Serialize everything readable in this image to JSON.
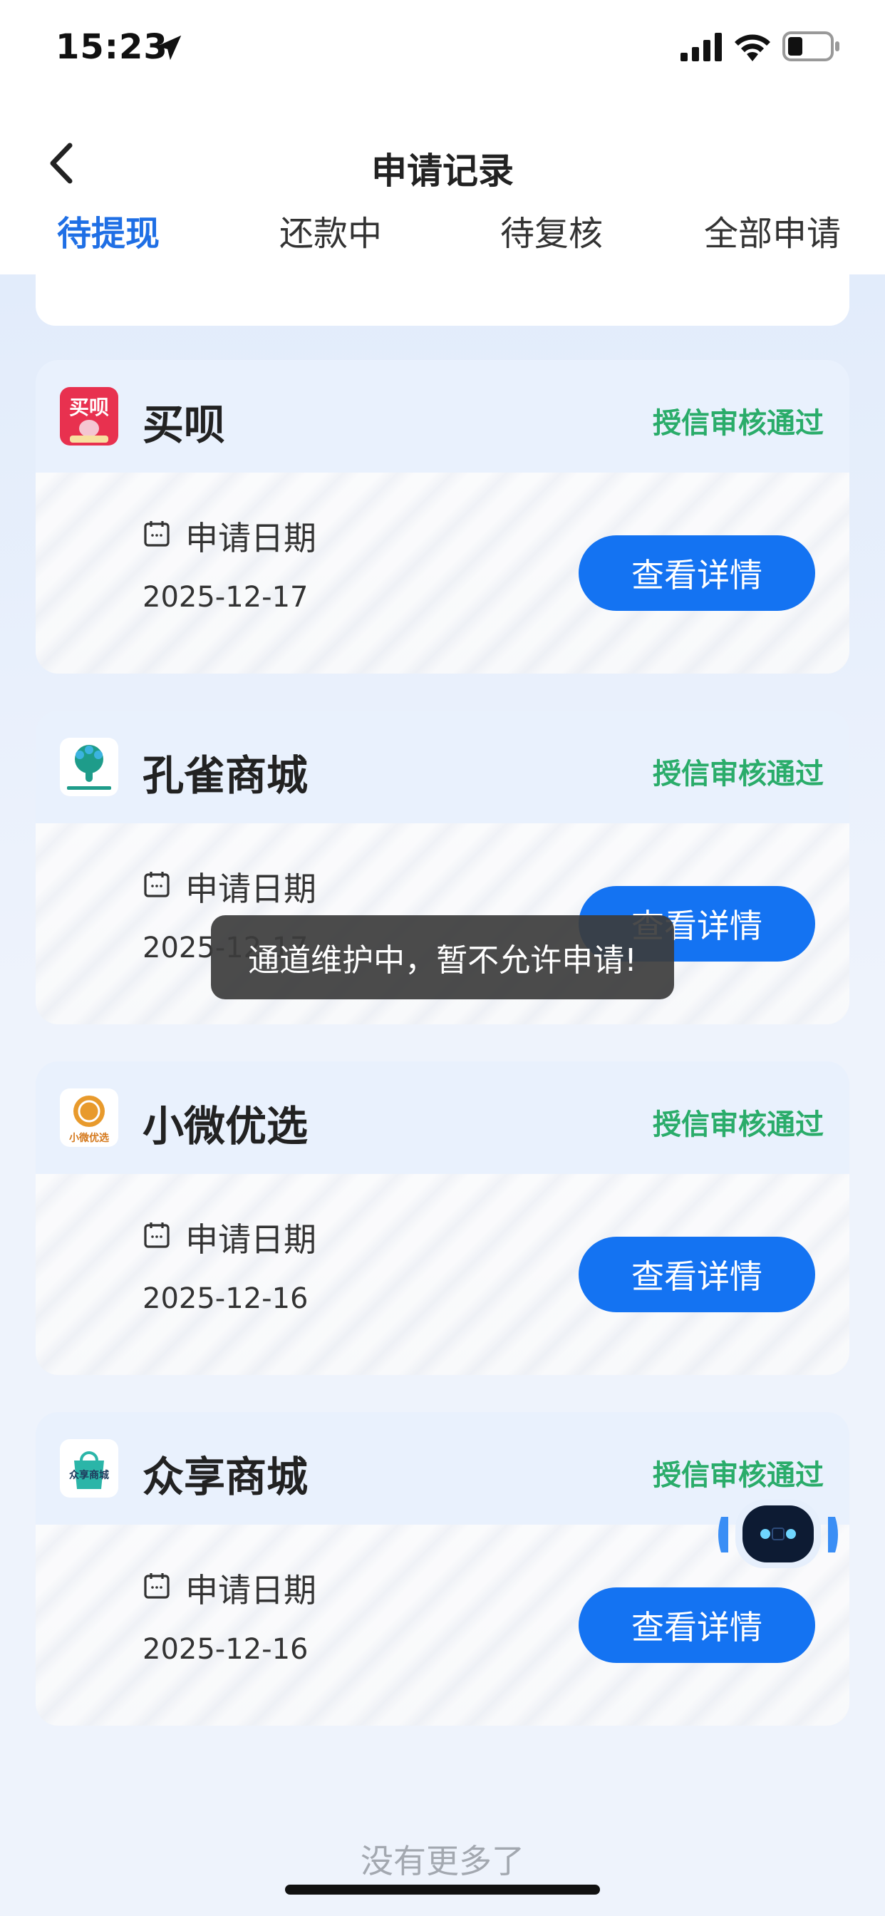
{
  "status_bar": {
    "time": "15:23"
  },
  "header": {
    "title": "申请记录",
    "tabs": [
      {
        "label": "待提现",
        "active": true
      },
      {
        "label": "还款中",
        "active": false
      },
      {
        "label": "待复核",
        "active": false
      },
      {
        "label": "全部申请",
        "active": false
      }
    ]
  },
  "cards": [
    {
      "logo_icon": "maibei-logo-icon",
      "logo_text": "买呗",
      "name": "买呗",
      "status": "授信审核通过",
      "date_label": "申请日期",
      "date": "2025-12-17",
      "button": "查看详情"
    },
    {
      "logo_icon": "peacock-logo-icon",
      "name": "孔雀商城",
      "status": "授信审核通过",
      "date_label": "申请日期",
      "date": "2025-12-17",
      "button": "查看详情"
    },
    {
      "logo_icon": "xiaowei-logo-icon",
      "logo_text": "小微优选",
      "name": "小微优选",
      "status": "授信审核通过",
      "date_label": "申请日期",
      "date": "2025-12-16",
      "button": "查看详情"
    },
    {
      "logo_icon": "zhongxiang-logo-icon",
      "logo_text": "众享商城",
      "name": "众享商城",
      "status": "授信审核通过",
      "date_label": "申请日期",
      "date": "2025-12-16",
      "button": "查看详情"
    }
  ],
  "toast": {
    "message": "通道维护中，暂不允许申请!"
  },
  "footer": {
    "text": "没有更多了"
  },
  "colors": {
    "accent": "#1473f2",
    "active_tab": "#1f6fe5",
    "status_green": "#2aac6a"
  }
}
